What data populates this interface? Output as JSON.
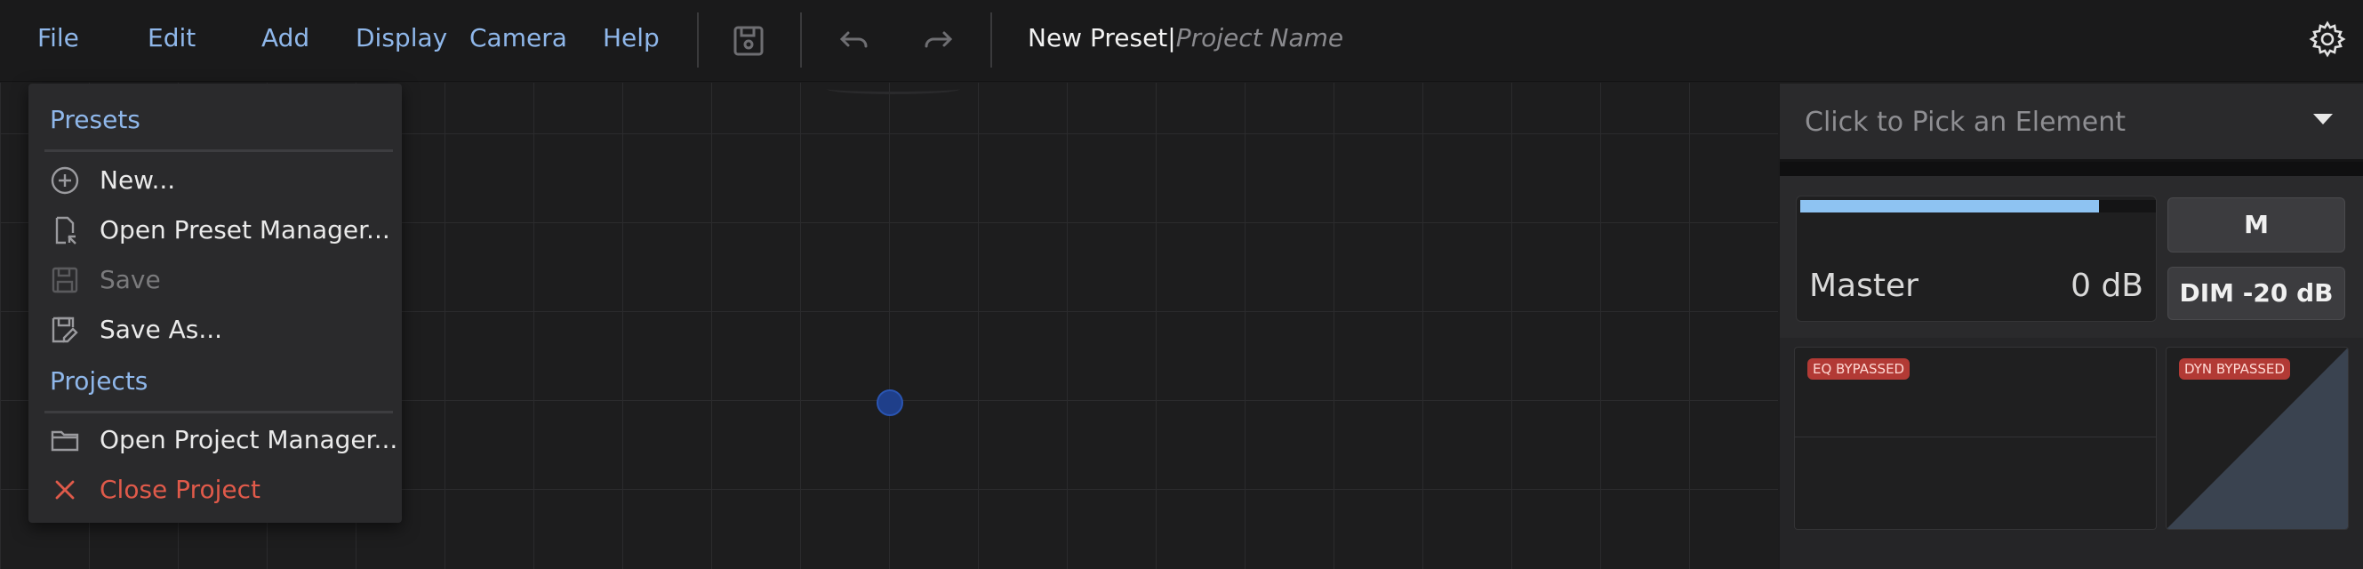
{
  "menubar": {
    "items": [
      "File",
      "Edit",
      "Add",
      "Display",
      "Camera",
      "Help"
    ],
    "preset_name": "New Preset",
    "title_separator": "|",
    "project_name_placeholder": "Project Name",
    "icons": [
      "save-icon",
      "undo-icon",
      "redo-icon",
      "settings-gear-icon"
    ]
  },
  "file_menu": {
    "presets_heading": "Presets",
    "new_label": "New...",
    "open_preset_manager_label": "Open Preset Manager...",
    "save_label": "Save",
    "save_as_label": "Save As...",
    "projects_heading": "Projects",
    "open_project_manager_label": "Open Project Manager...",
    "close_project_label": "Close Project"
  },
  "panel": {
    "picker_placeholder": "Click to Pick an Element",
    "master": {
      "label": "Master",
      "value": "0 dB",
      "meter_level": 0.84
    },
    "mute_button": "M",
    "dim_button": "DIM -20 dB",
    "eq_badge": "EQ BYPASSED",
    "dyn_badge": "DYN BYPASSED"
  },
  "colors": {
    "accent": "#8fb7ea",
    "danger": "#e05a4a",
    "badge": "#b23a35",
    "meter": "#8ec3f2"
  }
}
